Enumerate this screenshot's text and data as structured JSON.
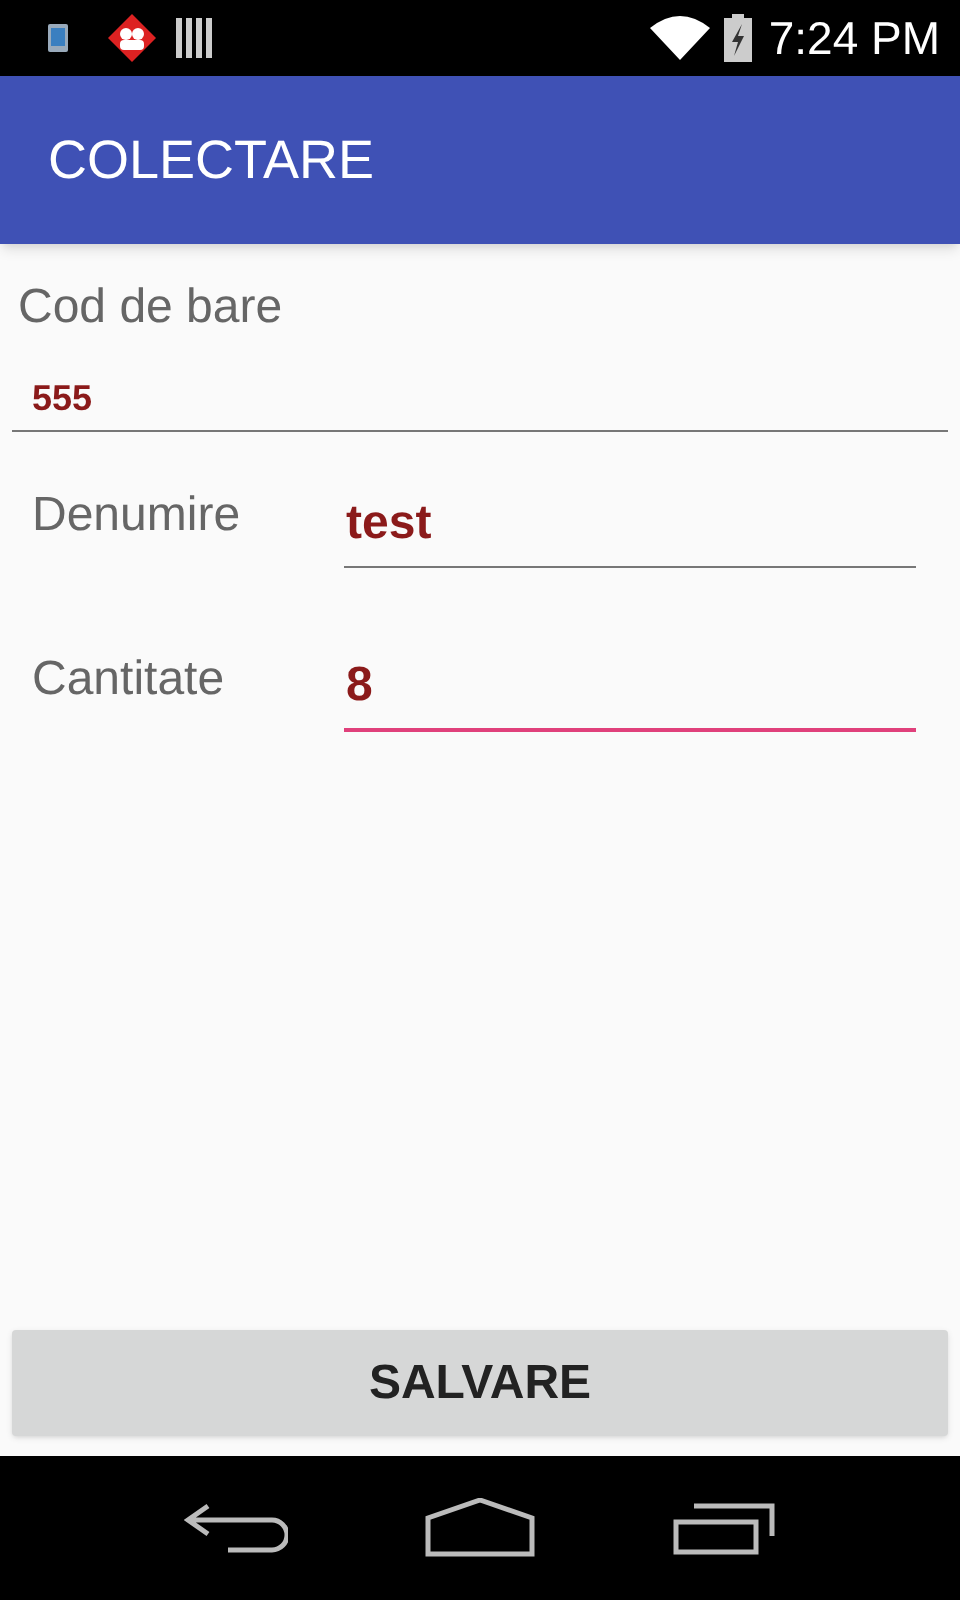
{
  "status_bar": {
    "time": "7:24 PM"
  },
  "app_bar": {
    "title": "COLECTARE"
  },
  "barcode": {
    "label": "Cod de bare",
    "value": "555",
    "focused": false
  },
  "fields": [
    {
      "label": "Denumire",
      "value": "test",
      "focused": false
    },
    {
      "label": "Cantitate",
      "value": "8",
      "focused": true
    }
  ],
  "save_button": {
    "label": "SALVARE"
  }
}
